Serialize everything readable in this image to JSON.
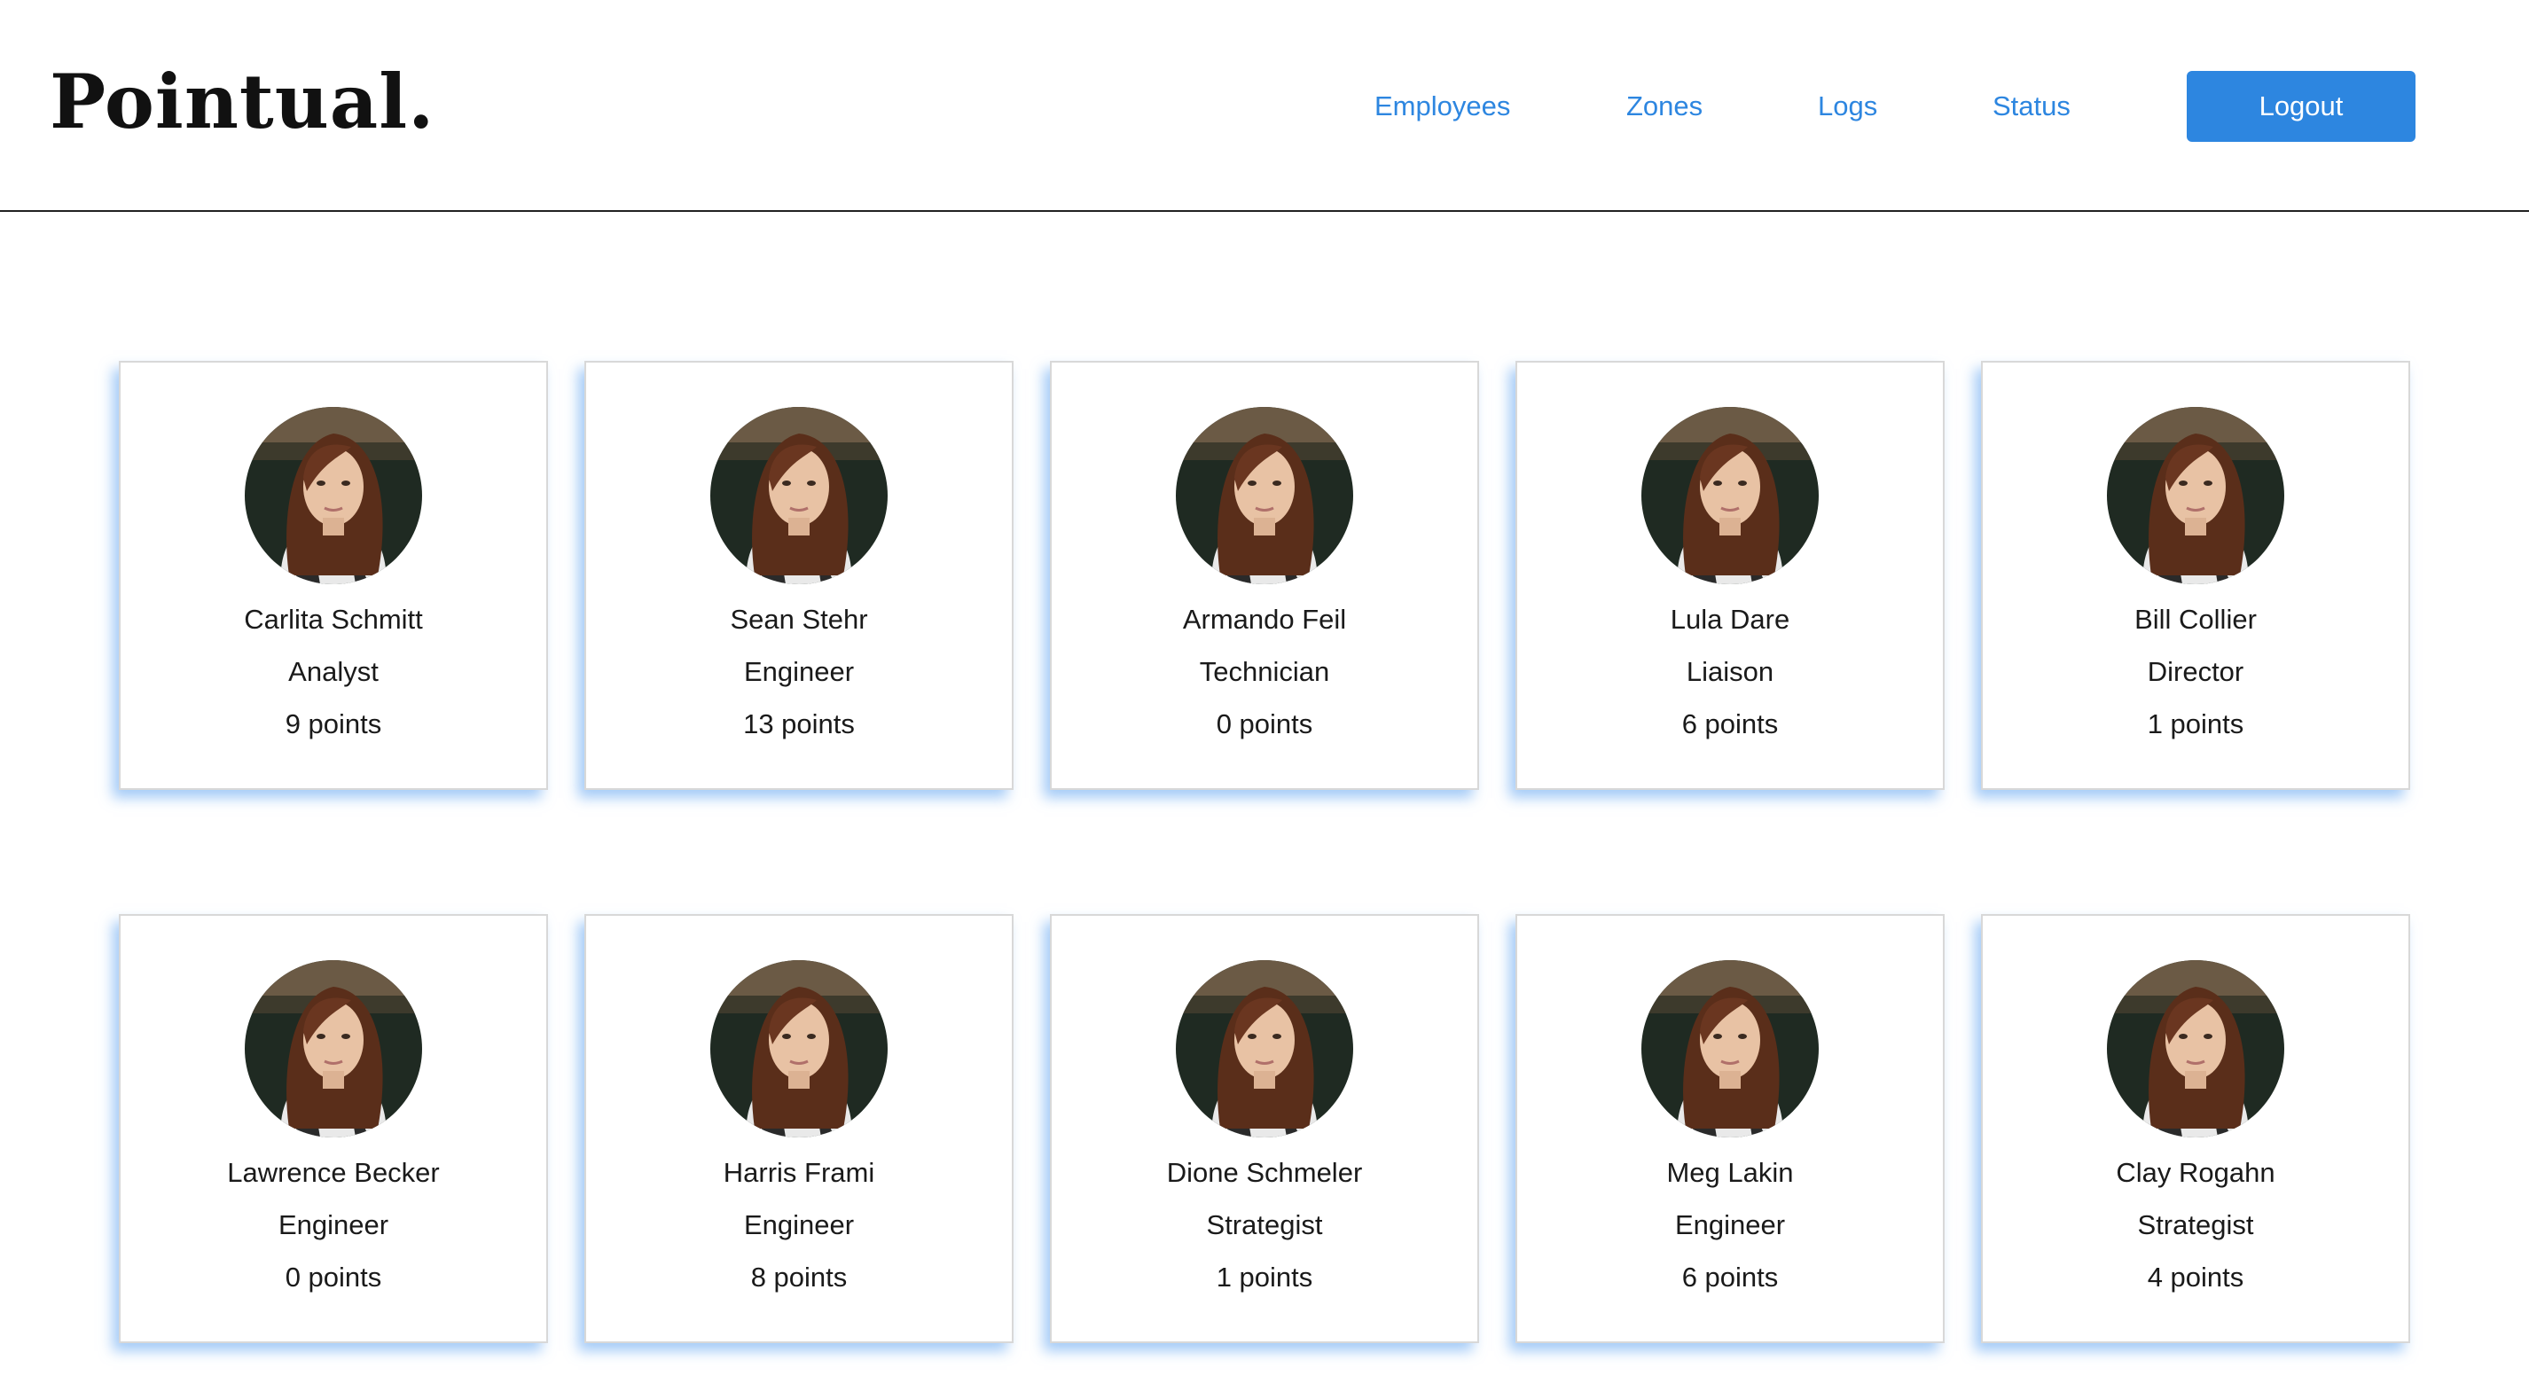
{
  "header": {
    "logo": "Pointual.",
    "nav": [
      {
        "label": "Employees"
      },
      {
        "label": "Zones"
      },
      {
        "label": "Logs"
      },
      {
        "label": "Status"
      }
    ],
    "logout_label": "Logout"
  },
  "employees": [
    {
      "name": "Carlita Schmitt",
      "role": "Analyst",
      "points": "9 points"
    },
    {
      "name": "Sean Stehr",
      "role": "Engineer",
      "points": "13 points"
    },
    {
      "name": "Armando Feil",
      "role": "Technician",
      "points": "0 points"
    },
    {
      "name": "Lula Dare",
      "role": "Liaison",
      "points": "6 points"
    },
    {
      "name": "Bill Collier",
      "role": "Director",
      "points": "1 points"
    },
    {
      "name": "Lawrence Becker",
      "role": "Engineer",
      "points": "0 points"
    },
    {
      "name": "Harris Frami",
      "role": "Engineer",
      "points": "8 points"
    },
    {
      "name": "Dione Schmeler",
      "role": "Strategist",
      "points": "1 points"
    },
    {
      "name": "Meg Lakin",
      "role": "Engineer",
      "points": "6 points"
    },
    {
      "name": "Clay Rogahn",
      "role": "Strategist",
      "points": "4 points"
    }
  ],
  "colors": {
    "accent": "#2d86e0",
    "card_shadow": "#5aa0f0",
    "text": "#1a1a1a"
  }
}
